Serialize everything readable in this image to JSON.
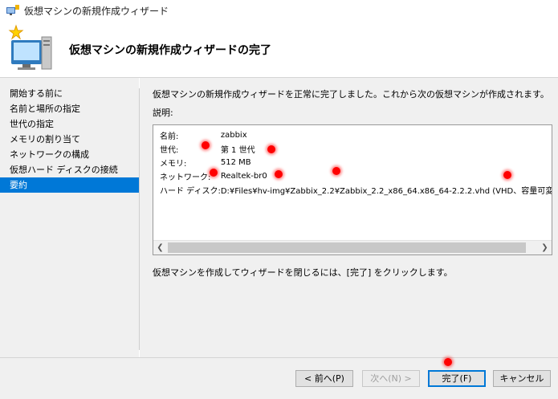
{
  "window": {
    "title": "仮想マシンの新規作成ウィザード"
  },
  "header": {
    "heading": "仮想マシンの新規作成ウィザードの完了",
    "icon": "new-vm-wizard-icon"
  },
  "sidebar": {
    "items": [
      {
        "label": "開始する前に",
        "active": false
      },
      {
        "label": "名前と場所の指定",
        "active": false
      },
      {
        "label": "世代の指定",
        "active": false
      },
      {
        "label": "メモリの割り当て",
        "active": false
      },
      {
        "label": "ネットワークの構成",
        "active": false
      },
      {
        "label": "仮想ハード ディスクの接続",
        "active": false
      },
      {
        "label": "要約",
        "active": true
      }
    ]
  },
  "main": {
    "intro": "仮想マシンの新規作成ウィザードを正常に完了しました。これから次の仮想マシンが作成されます。",
    "description_label": "説明:",
    "summary": [
      {
        "key": "名前:",
        "value": "zabbix"
      },
      {
        "key": "世代:",
        "value": "第 1 世代"
      },
      {
        "key": "メモリ:",
        "value": "512 MB"
      },
      {
        "key": "ネットワーク:",
        "value": "Realtek-br0"
      },
      {
        "key": "ハード ディスク:",
        "value": "D:¥Files¥hv-img¥Zabbix_2.2¥Zabbix_2.2_x86_64.x86_64-2.2.2.vhd (VHD、容量可変"
      }
    ],
    "finish_note": "仮想マシンを作成してウィザードを閉じるには、[完了] をクリックします。"
  },
  "footer": {
    "back": "< 前へ(P)",
    "next": "次へ(N) >",
    "finish": "完了(F)",
    "cancel": "キャンセル"
  },
  "colors": {
    "accent": "#0078d7",
    "marker": "#ff0000"
  }
}
